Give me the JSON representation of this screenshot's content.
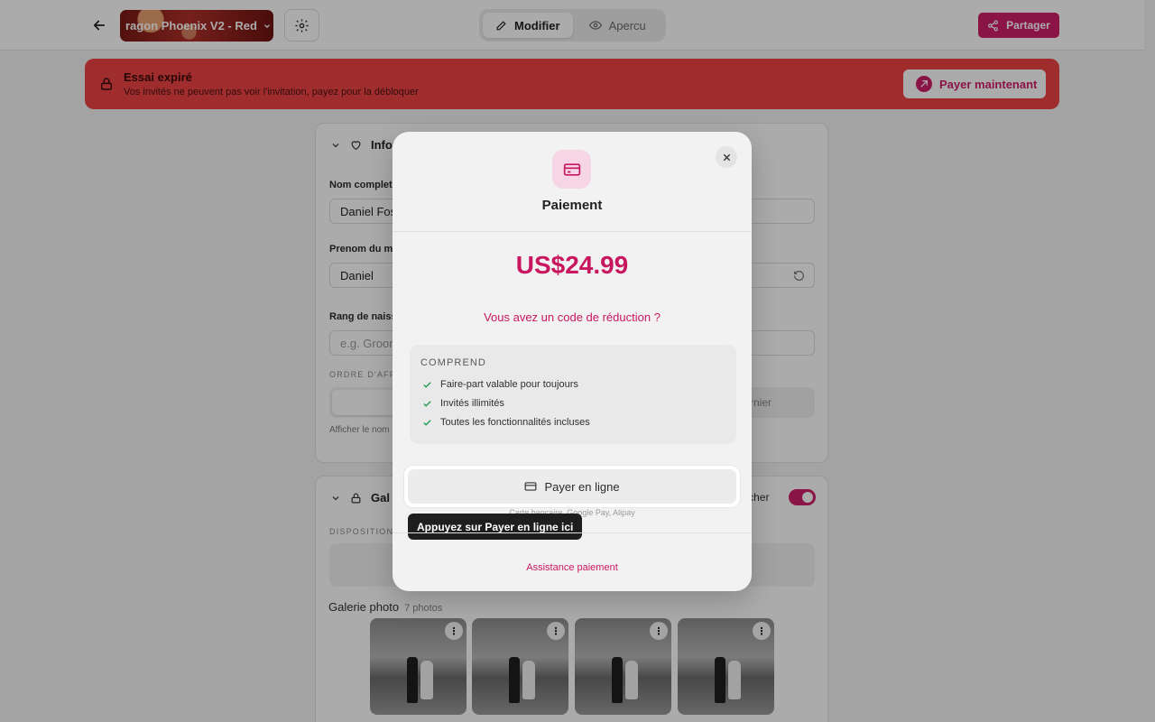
{
  "topbar": {
    "theme_name": "ragon Phoenix V2 - Red",
    "mode_edit": "Modifier",
    "mode_preview": "Apercu",
    "share_label": "Partager"
  },
  "banner": {
    "title": "Essai expiré",
    "subtitle": "Vos invités ne peuvent pas voir l'invitation, payez pour la débloquer",
    "pay_now": "Payer maintenant"
  },
  "form": {
    "section_title": "Infor",
    "full_name_label": "Nom complet",
    "full_name_value": "Daniel Fos",
    "first_name_label": "Prenom du ma",
    "first_name_value": "Daniel",
    "rank_label": "Rang de naiss",
    "rank_placeholder": "e.g. Groom",
    "display_order_label": "ORDRE D'AFFIC",
    "seg_first": "Fa",
    "seg_last": "rnier",
    "hint": "Afficher le nom"
  },
  "gallery_section": {
    "title": "Gal",
    "toggle_label": "fficher",
    "layout_label": "DISPOSITION",
    "gallery_title": "Galerie photo",
    "gallery_count": "7 photos"
  },
  "modal": {
    "title": "Paiement",
    "price": "US$24.99",
    "promo": "Vous avez un code de réduction ?",
    "includes_title": "COMPREND",
    "includes": [
      "Faire-part valable pour toujours",
      "Invités illimités",
      "Toutes les fonctionnalités incluses"
    ],
    "pay_online": "Payer en ligne",
    "methods": "Carte bancaire, Google Pay, Alipay",
    "tooltip": "Appuyez sur Payer en ligne ici",
    "support": "Assistance paiement"
  },
  "colors": {
    "brand": "#d01f6b",
    "banner": "#ef4444",
    "check": "#1f9d55"
  }
}
